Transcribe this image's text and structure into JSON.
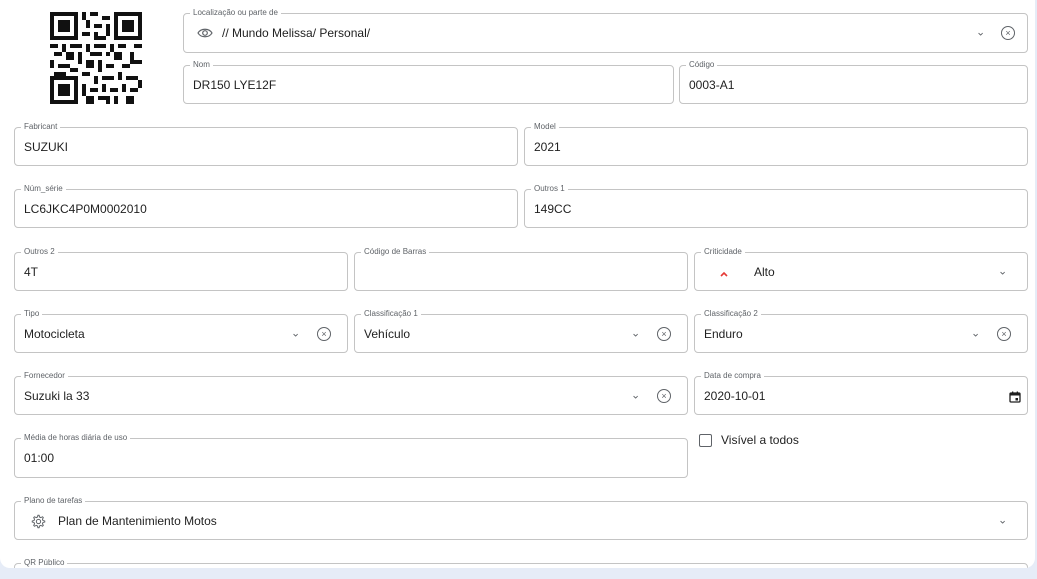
{
  "location": {
    "label": "Localização ou parte de",
    "value": "// Mundo Melissa/ Personal/"
  },
  "nome": {
    "label": "Nom",
    "value": "DR150 LYE12F"
  },
  "codigo": {
    "label": "Código",
    "value": "0003-A1"
  },
  "fabricante": {
    "label": "Fabricant",
    "value": "SUZUKI"
  },
  "modelo": {
    "label": "Model",
    "value": "2021"
  },
  "num_serie": {
    "label": "Núm_série",
    "value": "LC6JKC4P0M0002010"
  },
  "outros1": {
    "label": "Outros 1",
    "value": "149CC"
  },
  "outros2": {
    "label": "Outros 2",
    "value": "4T"
  },
  "codigo_barras": {
    "label": "Código de Barras",
    "value": ""
  },
  "criticidade": {
    "label": "Criticidade",
    "value": "Alto"
  },
  "tipo": {
    "label": "Tipo",
    "value": "Motocicleta"
  },
  "classificacao1": {
    "label": "Classificação 1",
    "value": "Vehículo"
  },
  "classificacao2": {
    "label": "Classificação 2",
    "value": "Enduro"
  },
  "fornecedor": {
    "label": "Fornecedor",
    "value": "Suzuki la 33"
  },
  "data_compra": {
    "label": "Data de compra",
    "value": "2020-10-01"
  },
  "media_horas": {
    "label": "Média de horas diária de uso",
    "value": "01:00"
  },
  "visivel": {
    "label": "Visível a todos",
    "checked": false
  },
  "plano_tarefas": {
    "label": "Plano de tarefas",
    "value": "Plan de Mantenimiento Motos"
  },
  "qr_publico": {
    "label": "QR Público"
  },
  "icons": {
    "location": "eye-icon",
    "plano": "gear-icon",
    "criticidade": "chevron-up-icon",
    "dropdown": "chevron-down-icon",
    "clear": "clear-circle-icon",
    "date": "calendar-icon"
  },
  "colors": {
    "criticidade_high": "#e53935",
    "border": "#c4c4c4",
    "background": "#e6ecf7"
  }
}
